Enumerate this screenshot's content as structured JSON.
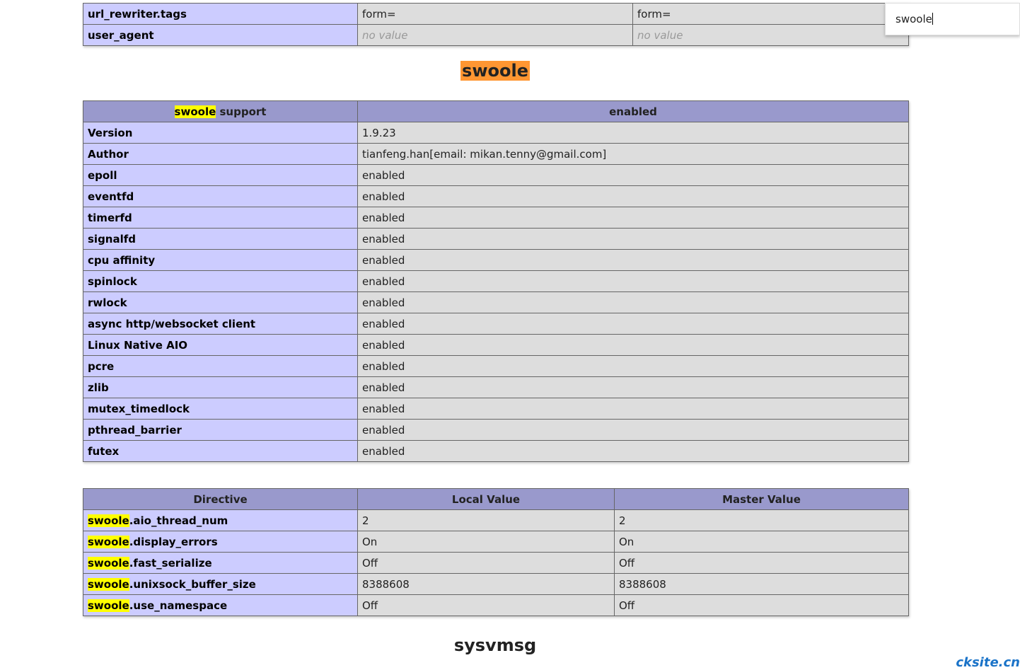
{
  "top_table": {
    "rows": [
      {
        "directive": "url_rewriter.tags",
        "local": "form=",
        "master": "form="
      },
      {
        "directive": "user_agent",
        "local": "no value",
        "master": "no value"
      }
    ]
  },
  "swoole_section": {
    "title": "swoole",
    "support_header": {
      "highlight": "swoole",
      "rest": " support",
      "value": "enabled"
    },
    "rows": [
      {
        "key": "Version",
        "value": "1.9.23"
      },
      {
        "key": "Author",
        "value": "tianfeng.han[email: mikan.tenny@gmail.com]"
      },
      {
        "key": "epoll",
        "value": "enabled"
      },
      {
        "key": "eventfd",
        "value": "enabled"
      },
      {
        "key": "timerfd",
        "value": "enabled"
      },
      {
        "key": "signalfd",
        "value": "enabled"
      },
      {
        "key": "cpu affinity",
        "value": "enabled"
      },
      {
        "key": "spinlock",
        "value": "enabled"
      },
      {
        "key": "rwlock",
        "value": "enabled"
      },
      {
        "key": "async http/websocket client",
        "value": "enabled"
      },
      {
        "key": "Linux Native AIO",
        "value": "enabled"
      },
      {
        "key": "pcre",
        "value": "enabled"
      },
      {
        "key": "zlib",
        "value": "enabled"
      },
      {
        "key": "mutex_timedlock",
        "value": "enabled"
      },
      {
        "key": "pthread_barrier",
        "value": "enabled"
      },
      {
        "key": "futex",
        "value": "enabled"
      }
    ]
  },
  "directives": {
    "headers": {
      "directive": "Directive",
      "local": "Local Value",
      "master": "Master Value"
    },
    "highlight": "swoole",
    "rows": [
      {
        "suffix": ".aio_thread_num",
        "local": "2",
        "master": "2"
      },
      {
        "suffix": ".display_errors",
        "local": "On",
        "master": "On"
      },
      {
        "suffix": ".fast_serialize",
        "local": "Off",
        "master": "Off"
      },
      {
        "suffix": ".unixsock_buffer_size",
        "local": "8388608",
        "master": "8388608"
      },
      {
        "suffix": ".use_namespace",
        "local": "Off",
        "master": "Off"
      }
    ]
  },
  "next_section": {
    "title": "sysvmsg"
  },
  "find_bar": {
    "query": "swoole"
  },
  "watermark": {
    "text": "cksite.cn"
  },
  "colors": {
    "header": "#9999cc",
    "key_cell": "#ccccff",
    "value_cell": "#dddddd",
    "highlight": "#ffff00",
    "active_match": "#ff9632"
  }
}
